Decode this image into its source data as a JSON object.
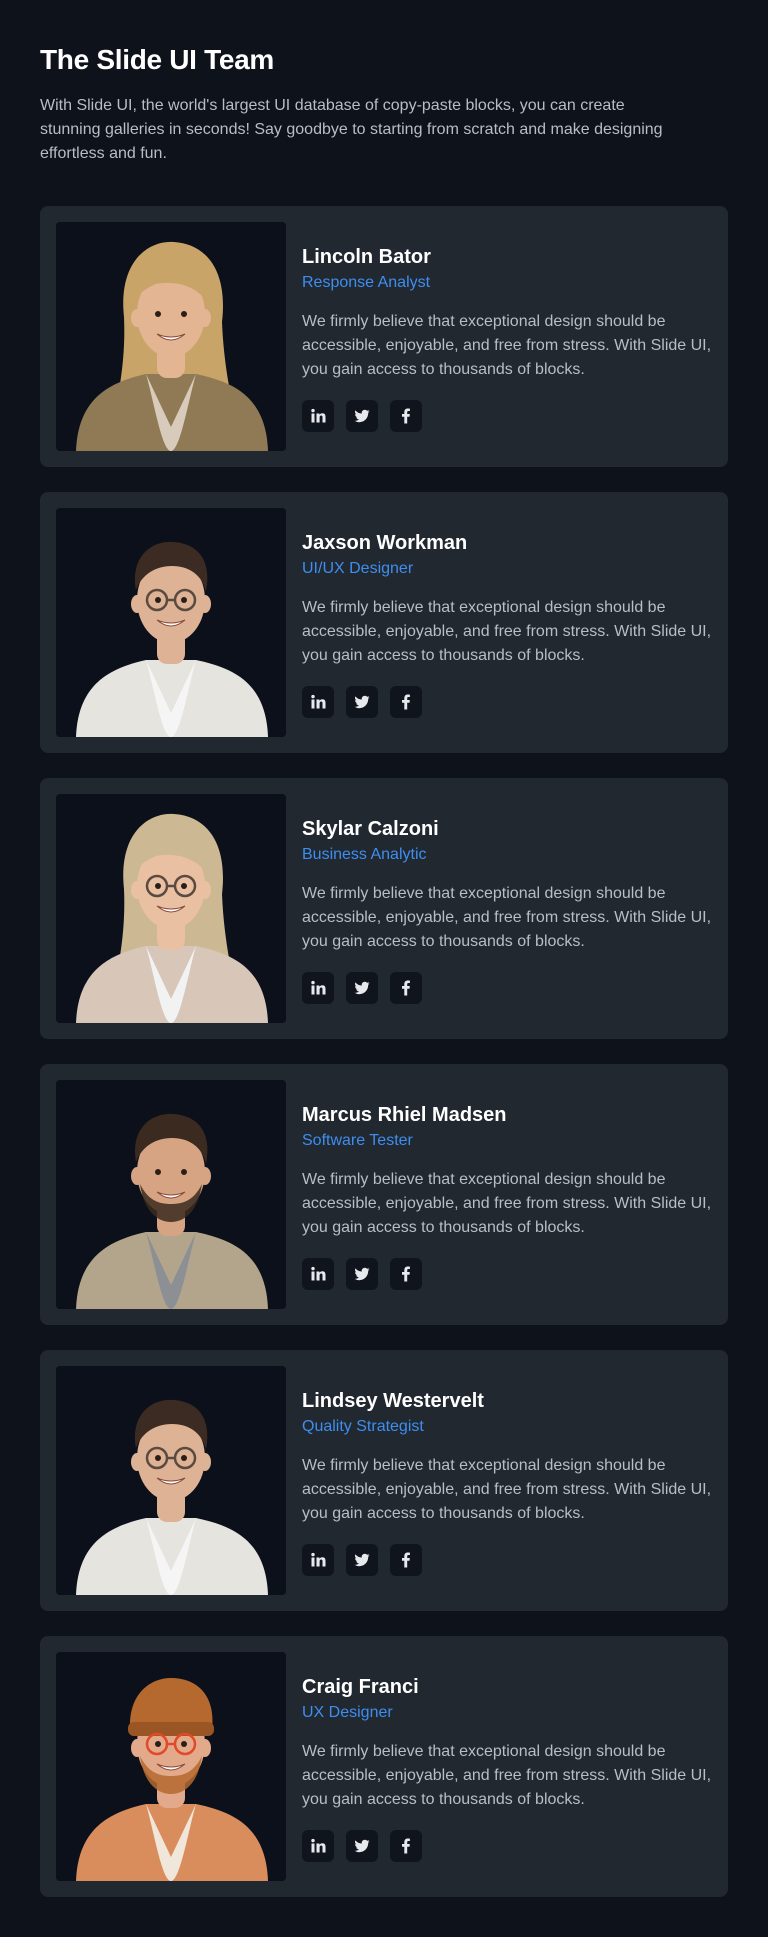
{
  "header": {
    "title": "The Slide UI Team",
    "intro": "With Slide UI, the world's largest UI database of copy-paste blocks, you can create stunning galleries in seconds! Say goodbye to starting from scratch and make designing effortless and fun."
  },
  "colors": {
    "background": "#0d121b",
    "card": "#222830",
    "accent": "#3d8ef0",
    "text_muted": "#b8bdc6"
  },
  "team": [
    {
      "name": "Lincoln Bator",
      "role": "Response Analyst",
      "bio": "We firmly believe that exceptional design should be accessible, enjoyable, and free from stress. With Slide UI, you gain access to thousands of blocks.",
      "photo": {
        "hair": "#c9a469",
        "skin": "#e3b592",
        "shirt": "#8f7a55",
        "inner": "#d8cbbb",
        "long_hair": true,
        "glasses": false,
        "hat": false,
        "beard": false
      }
    },
    {
      "name": "Jaxson Workman",
      "role": "UI/UX Designer",
      "bio": "We firmly believe that exceptional design should be accessible, enjoyable, and free from stress. With Slide UI, you gain access to thousands of blocks.",
      "photo": {
        "hair": "#3b2b22",
        "skin": "#deb294",
        "shirt": "#e6e4df",
        "inner": "#f5f5f5",
        "long_hair": false,
        "glasses": true,
        "hat": false,
        "beard": false
      }
    },
    {
      "name": "Skylar Calzoni",
      "role": "Business Analytic",
      "bio": "We firmly believe that exceptional design should be accessible, enjoyable, and free from stress. With Slide UI, you gain access to thousands of blocks.",
      "photo": {
        "hair": "#cdb894",
        "skin": "#eac0a2",
        "shirt": "#d8c6b8",
        "inner": "#f2f2f2",
        "long_hair": true,
        "glasses": true,
        "hat": false,
        "beard": false
      }
    },
    {
      "name": "Marcus Rhiel Madsen",
      "role": "Software Tester",
      "bio": "We firmly believe that exceptional design should be accessible, enjoyable, and free from stress. With Slide UI, you gain access to thousands of blocks.",
      "photo": {
        "hair": "#3a2a20",
        "skin": "#d6a482",
        "shirt": "#b3a58c",
        "inner": "#8c8f93",
        "long_hair": false,
        "glasses": false,
        "hat": false,
        "beard": true
      }
    },
    {
      "name": "Lindsey Westervelt",
      "role": "Quality Strategist",
      "bio": "We firmly believe that exceptional design should be accessible, enjoyable, and free from stress. With Slide UI, you gain access to thousands of blocks.",
      "photo": {
        "hair": "#3b2b22",
        "skin": "#deb294",
        "shirt": "#e6e4df",
        "inner": "#f5f5f5",
        "long_hair": false,
        "glasses": true,
        "hat": false,
        "beard": false
      }
    },
    {
      "name": "Craig Franci",
      "role": "UX Designer",
      "bio": "We firmly believe that exceptional design should be accessible, enjoyable, and free from stress. With Slide UI, you gain access to thousands of blocks.",
      "photo": {
        "hair": "#b5692e",
        "skin": "#e2a98a",
        "shirt": "#d98c5c",
        "inner": "#f0e6da",
        "long_hair": false,
        "glasses": true,
        "hat": true,
        "beard": true
      }
    }
  ],
  "social_icons": [
    "linkedin-icon",
    "twitter-icon",
    "facebook-icon"
  ]
}
